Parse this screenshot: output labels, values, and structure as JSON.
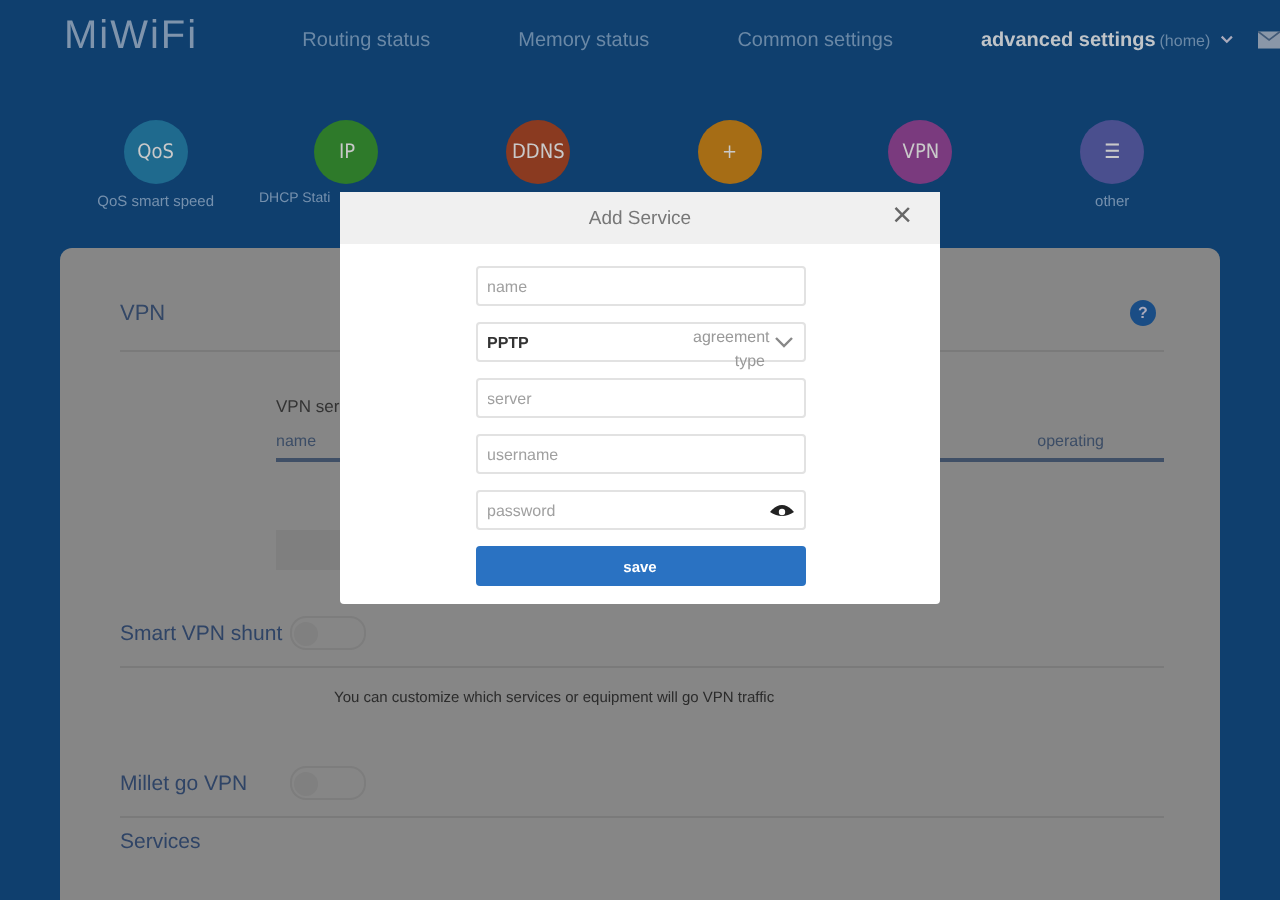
{
  "header": {
    "logo": "MiWiFi",
    "nav": [
      {
        "label": "Routing status",
        "selected": false
      },
      {
        "label": "Memory status",
        "selected": false
      },
      {
        "label": "Common settings",
        "selected": false
      },
      {
        "label": "advanced settings",
        "selected": true
      }
    ],
    "router_name": "(home)"
  },
  "apps": [
    {
      "glyph": "QoS",
      "label": "QoS smart speed",
      "color": "#1f6a8e"
    },
    {
      "glyph": "IP",
      "label": "DHCP Stati",
      "color": "#2e7a2a"
    },
    {
      "glyph": "DDNS",
      "color": "#8a3a20"
    },
    {
      "glyph": "+",
      "color": "#a66d15"
    },
    {
      "glyph": "VPN",
      "color": "#7a3a7e"
    },
    {
      "glyph": "☰",
      "label": "other",
      "color": "#4a4f8e"
    }
  ],
  "card": {
    "title": "VPN",
    "help": "?",
    "list_title": "VPN ser",
    "columns": [
      "name",
      "operating"
    ],
    "settings": [
      {
        "label": "Smart VPN shunt",
        "on": false,
        "note": "You can customize which services or equipment will go VPN traffic"
      },
      {
        "label": "Millet go VPN",
        "on": false
      }
    ],
    "last_label": "Services"
  },
  "dialog": {
    "title": "Add Service",
    "close": "×",
    "name_placeholder": "name",
    "protocol": "PPTP",
    "protocol_label": "agreement type",
    "server_placeholder": "server",
    "username_placeholder": "username",
    "password_placeholder": "password",
    "save": "save"
  }
}
